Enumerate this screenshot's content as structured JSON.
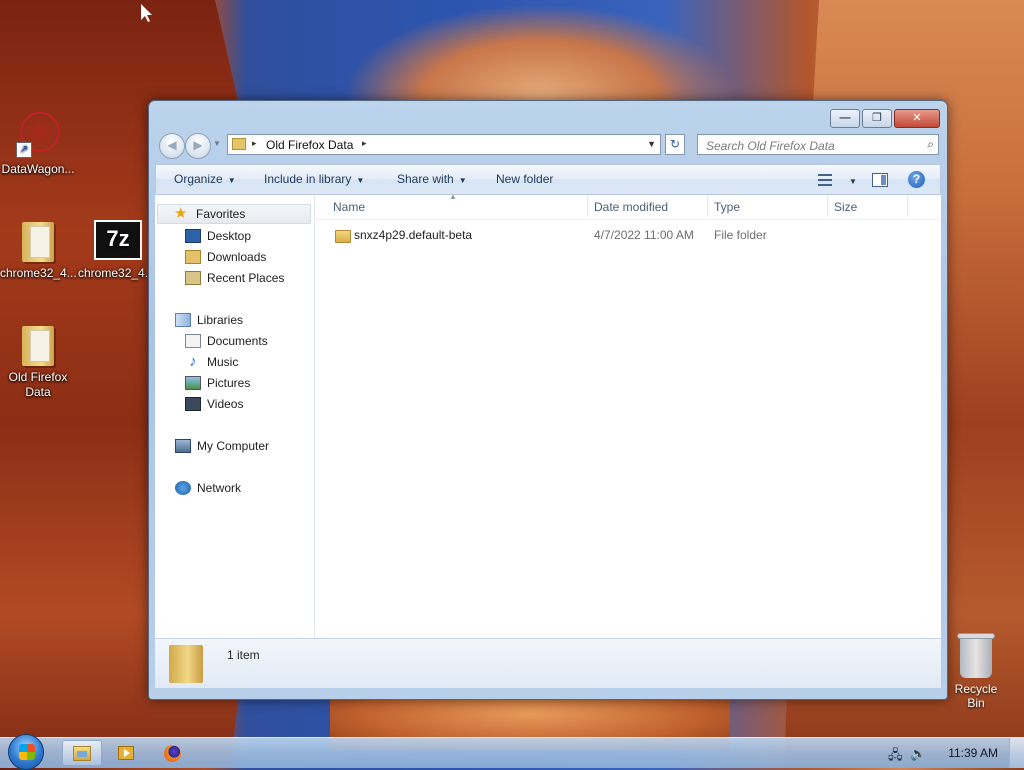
{
  "desktop": {
    "icons": [
      {
        "label": "DataWagon..."
      },
      {
        "label": "chrome32_4..."
      },
      {
        "label": "chrome32_4..."
      },
      {
        "label": "Old Firefox Data"
      }
    ],
    "seven_zip_glyph": "7z",
    "recycle_bin": "Recycle Bin"
  },
  "window": {
    "address": {
      "crumb": "Old Firefox Data",
      "sep": "▸"
    },
    "search": {
      "placeholder": "Search Old Firefox Data"
    },
    "toolbar": {
      "organize": "Organize",
      "include_in_library": "Include in library",
      "share_with": "Share with",
      "new_folder": "New folder"
    },
    "nav_pane": {
      "favorites": "Favorites",
      "desktop": "Desktop",
      "downloads": "Downloads",
      "recent_places": "Recent Places",
      "libraries": "Libraries",
      "documents": "Documents",
      "music": "Music",
      "pictures": "Pictures",
      "videos": "Videos",
      "my_computer": "My Computer",
      "network": "Network"
    },
    "columns": {
      "name": "Name",
      "date_modified": "Date modified",
      "type": "Type",
      "size": "Size"
    },
    "files": [
      {
        "name": "snxz4p29.default-beta",
        "date_modified": "4/7/2022 11:00 AM",
        "type": "File folder",
        "size": ""
      }
    ],
    "details": {
      "count": "1 item"
    }
  },
  "taskbar": {
    "clock": "11:39 AM"
  }
}
